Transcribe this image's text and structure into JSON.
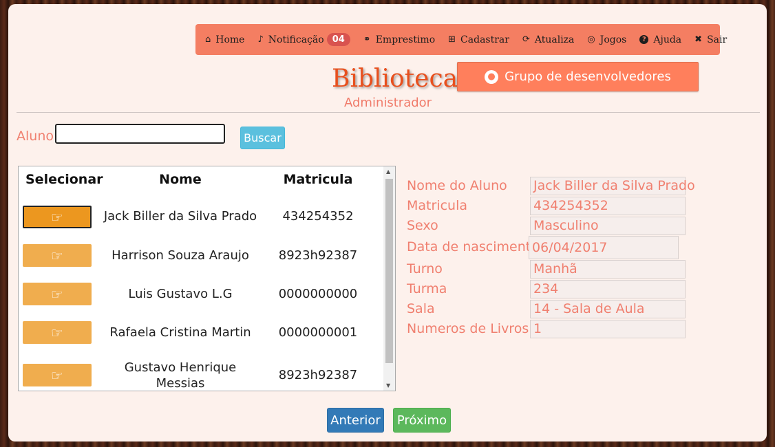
{
  "nav": {
    "items": [
      {
        "label": "Home",
        "icon": "home-icon",
        "glyph": "⌂"
      },
      {
        "label": "Notificação",
        "icon": "bell-icon",
        "glyph": "🔔",
        "badge": "04"
      },
      {
        "label": "Emprestimo",
        "icon": "handshake-icon",
        "glyph": "⚭"
      },
      {
        "label": "Cadastrar",
        "icon": "plus-square-icon",
        "glyph": "⊞"
      },
      {
        "label": "Atualiza",
        "icon": "refresh-icon",
        "glyph": "⟳"
      },
      {
        "label": "Jogos",
        "icon": "gamepad-icon",
        "glyph": "◎"
      },
      {
        "label": "Ajuda",
        "icon": "question-icon",
        "glyph": "?"
      },
      {
        "label": "Sair",
        "icon": "close-icon",
        "glyph": "✖"
      }
    ]
  },
  "brand": {
    "title": "Biblioteca",
    "subtitle": "Administrador"
  },
  "dev_button": {
    "label": "Grupo de desenvolvedores",
    "icon": "user-circle-icon"
  },
  "search": {
    "label": "Aluno",
    "value": "",
    "button": "Buscar"
  },
  "table": {
    "headers": {
      "select": "Selecionar",
      "name": "Nome",
      "id": "Matricula"
    },
    "rows": [
      {
        "name": "Jack Biller da Silva Prado",
        "id": "434254352",
        "selected": true
      },
      {
        "name": "Harrison Souza Araujo",
        "id": "8923h92387",
        "selected": false
      },
      {
        "name": "Luis Gustavo L.G",
        "id": "0000000000",
        "selected": false
      },
      {
        "name": "Rafaela Cristina Martin",
        "id": "0000000001",
        "selected": false
      },
      {
        "name": "Gustavo Henrique Messias",
        "id": "8923h92387",
        "selected": false
      }
    ]
  },
  "details": {
    "name_label": "Nome do Aluno",
    "name": "Jack Biller da Silva Prado",
    "id_label": "Matricula",
    "id": "434254352",
    "sex_label": "Sexo",
    "sex": "Masculino",
    "birth_label": "Data de nascimento",
    "birth": "06/04/2017",
    "shift_label": "Turno",
    "shift": "Manhã",
    "class_label": "Turma",
    "class": "234",
    "room_label": "Sala",
    "room": "14 - Sala de Aula",
    "books_label": "Numeros de Livros",
    "books": "1"
  },
  "pagination": {
    "prev": "Anterior",
    "next": "Próximo"
  },
  "colors": {
    "accent": "#f47e62",
    "brand": "#e8501e",
    "label": "#f08070",
    "select": "#f0ad4e"
  }
}
